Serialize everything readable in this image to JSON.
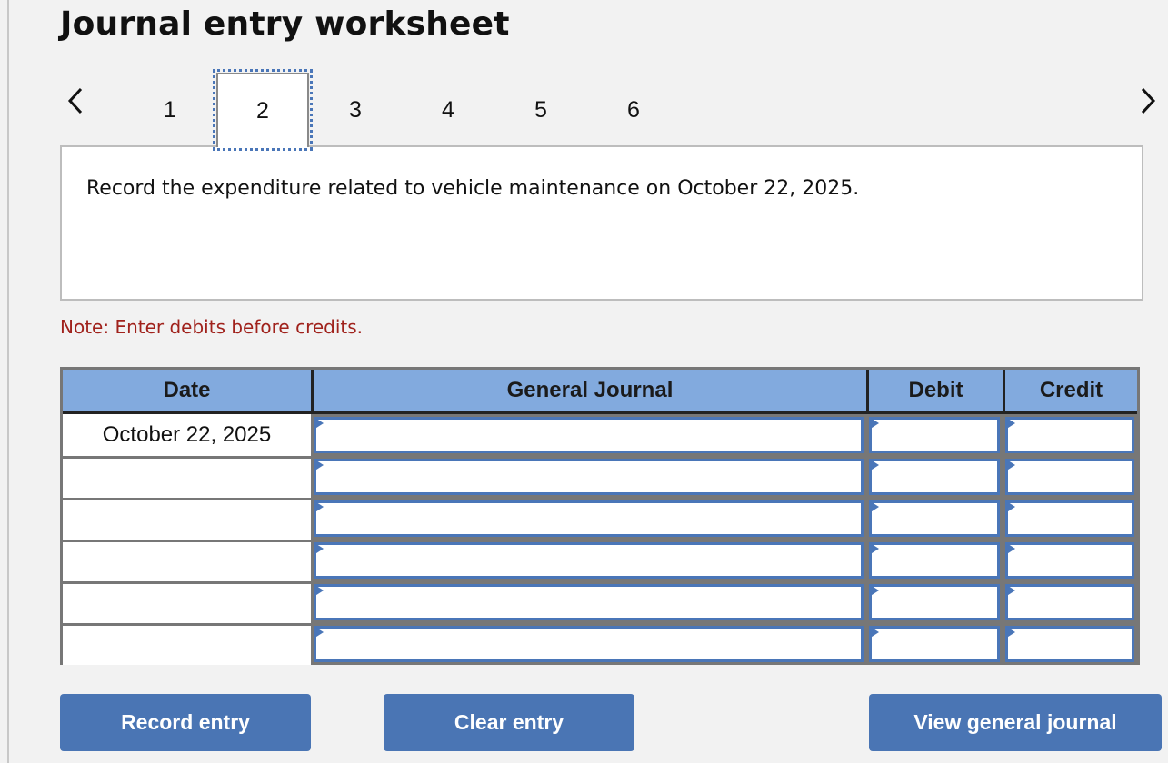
{
  "title": "Journal entry worksheet",
  "nav": {
    "prev_icon": "chevron-left-icon",
    "next_icon": "chevron-right-icon",
    "tabs": [
      {
        "label": "1",
        "active": false
      },
      {
        "label": "2",
        "active": true
      },
      {
        "label": "3",
        "active": false
      },
      {
        "label": "4",
        "active": false
      },
      {
        "label": "5",
        "active": false
      },
      {
        "label": "6",
        "active": false
      }
    ]
  },
  "prompt": "Record the expenditure related to vehicle maintenance on October 22, 2025.",
  "note": "Note: Enter debits before credits.",
  "table": {
    "headers": {
      "date": "Date",
      "general_journal": "General Journal",
      "debit": "Debit",
      "credit": "Credit"
    },
    "rows": [
      {
        "date": "October 22, 2025",
        "account": "",
        "debit": "",
        "credit": ""
      },
      {
        "date": "",
        "account": "",
        "debit": "",
        "credit": ""
      },
      {
        "date": "",
        "account": "",
        "debit": "",
        "credit": ""
      },
      {
        "date": "",
        "account": "",
        "debit": "",
        "credit": ""
      },
      {
        "date": "",
        "account": "",
        "debit": "",
        "credit": ""
      },
      {
        "date": "",
        "account": "",
        "debit": "",
        "credit": ""
      }
    ]
  },
  "buttons": {
    "record": "Record entry",
    "clear": "Clear entry",
    "view": "View general journal"
  },
  "colors": {
    "accent": "#4a75b4",
    "header_bg": "#82aade",
    "note_text": "#a0221c",
    "page_bg": "#f2f2f2"
  }
}
